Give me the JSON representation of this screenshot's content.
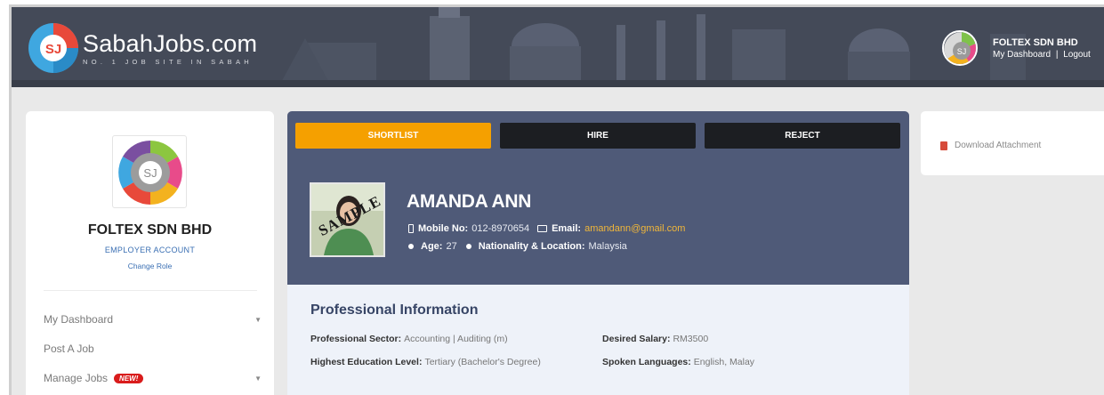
{
  "header": {
    "logo_title": "SabahJobs.com",
    "logo_tagline": "NO. 1 JOB SITE IN SABAH",
    "user_name": "FOLTEX SDN BHD",
    "link_dashboard": "My Dashboard",
    "link_separator": "|",
    "link_logout": "Logout"
  },
  "sidebar": {
    "company_name": "FOLTEX SDN BHD",
    "account_type": "EMPLOYER ACCOUNT",
    "change_role": "Change Role",
    "items": [
      {
        "label": "My Dashboard",
        "has_dropdown": true
      },
      {
        "label": "Post A Job",
        "has_dropdown": false
      },
      {
        "label": "Manage Jobs",
        "badge": "NEW!",
        "has_dropdown": true
      }
    ]
  },
  "actions": {
    "shortlist": "SHORTLIST",
    "hire": "HIRE",
    "reject": "REJECT"
  },
  "candidate": {
    "photo_stamp": "SAMPLE",
    "name": "AMANDA ANN",
    "mobile_label": "Mobile No:",
    "mobile": "012-8970654",
    "email_label": "Email:",
    "email": "amandann@gmail.com",
    "age_label": "Age:",
    "age": "27",
    "nationality_label": "Nationality & Location:",
    "nationality": "Malaysia"
  },
  "professional": {
    "title": "Professional Information",
    "sector_label": "Professional Sector:",
    "sector": "Accounting | Auditing (m)",
    "salary_label": "Desired Salary:",
    "salary": "RM3500",
    "education_label": "Highest Education Level:",
    "education": "Tertiary (Bachelor's Degree)",
    "languages_label": "Spoken Languages:",
    "languages": "English, Malay"
  },
  "attachment": {
    "download_label": "Download Attachment"
  },
  "colors": {
    "accent": "#f5a000",
    "panel": "#4f5a78",
    "dark_button": "#1c1e22",
    "link": "#3a6fb3",
    "badge": "#d91c1c"
  }
}
